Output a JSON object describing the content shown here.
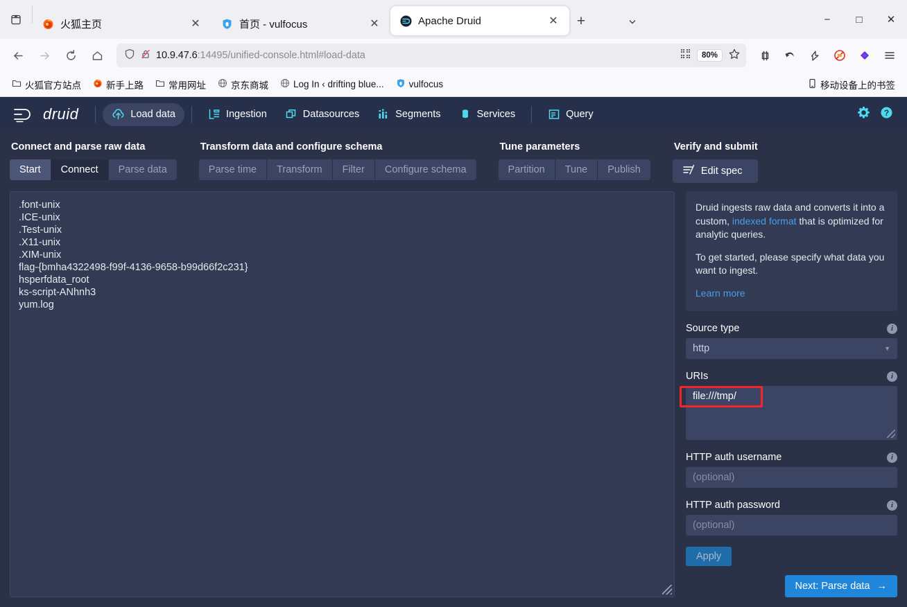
{
  "browser": {
    "tabs": [
      {
        "title": "火狐主页",
        "favicon": "firefox-icon",
        "active": false
      },
      {
        "title": "首页 - vulfocus",
        "favicon": "shield-icon",
        "active": false
      },
      {
        "title": "Apache Druid",
        "favicon": "druid-icon",
        "active": true
      }
    ],
    "tab_close_label": "✕",
    "new_tab_label": "+",
    "list_all_tabs_label": "⌄",
    "window_controls": {
      "minimize": "−",
      "maximize": "□",
      "close": "✕"
    },
    "nav": {
      "back": "←",
      "forward": "→",
      "reload": "⟳",
      "home": "⌂"
    },
    "url": {
      "host": "10.9.47.6",
      "rest": ":14495/unified-console.html#load-data",
      "shield_icon": "shield-icon",
      "lock_broken_icon": "lock-broken-icon",
      "qr_icon": "qr-code-icon",
      "zoom_level": "80%",
      "bookmark_icon": "star-icon"
    },
    "toolbar_icons": [
      "screenshot-icon",
      "undo-arrow-icon",
      "pocket-icon",
      "adblock-disabled-icon",
      "extension-diamond-icon",
      "app-menu-icon"
    ],
    "bookmarks": [
      {
        "label": "火狐官方站点",
        "icon": "folder-icon"
      },
      {
        "label": "新手上路",
        "icon": "firefox-icon"
      },
      {
        "label": "常用网址",
        "icon": "folder-icon"
      },
      {
        "label": "京东商城",
        "icon": "globe-icon"
      },
      {
        "label": "Log In ‹ drifting blue...",
        "icon": "globe-icon"
      },
      {
        "label": "vulfocus",
        "icon": "shield-icon"
      }
    ],
    "bookmarks_right": {
      "label": "移动设备上的书签",
      "icon": "mobile-icon"
    }
  },
  "druid": {
    "logo_text": "druid",
    "nav_items": [
      {
        "label": "Load data",
        "icon": "upload-cloud-icon",
        "active": true
      },
      {
        "label": "Ingestion",
        "icon": "ingestion-icon",
        "active": false
      },
      {
        "label": "Datasources",
        "icon": "datasources-icon",
        "active": false
      },
      {
        "label": "Segments",
        "icon": "segments-icon",
        "active": false
      },
      {
        "label": "Services",
        "icon": "services-icon",
        "active": false
      },
      {
        "label": "Query",
        "icon": "query-icon",
        "active": false
      }
    ],
    "nav_right": [
      {
        "icon": "gear-icon"
      },
      {
        "icon": "help-icon"
      }
    ],
    "wizard": [
      {
        "title": "Connect and parse raw data",
        "steps": [
          {
            "label": "Start",
            "state": "available"
          },
          {
            "label": "Connect",
            "state": "active"
          },
          {
            "label": "Parse data",
            "state": "disabled"
          }
        ]
      },
      {
        "title": "Transform data and configure schema",
        "steps": [
          {
            "label": "Parse time",
            "state": "disabled"
          },
          {
            "label": "Transform",
            "state": "disabled"
          },
          {
            "label": "Filter",
            "state": "disabled"
          },
          {
            "label": "Configure schema",
            "state": "disabled"
          }
        ]
      },
      {
        "title": "Tune parameters",
        "steps": [
          {
            "label": "Partition",
            "state": "disabled"
          },
          {
            "label": "Tune",
            "state": "disabled"
          },
          {
            "label": "Publish",
            "state": "disabled"
          }
        ]
      },
      {
        "title": "Verify and submit",
        "steps": [
          {
            "label": "Edit spec",
            "state": "editspec",
            "icon": "edit-spec-icon"
          }
        ]
      }
    ],
    "raw_data_lines": [
      ".font-unix",
      ".ICE-unix",
      ".Test-unix",
      ".X11-unix",
      ".XIM-unix",
      "flag-{bmha4322498-f99f-4136-9658-b99d66f2c231}",
      "hsperfdata_root",
      "ks-script-ANhnh3",
      "yum.log"
    ],
    "sidebar": {
      "info_p1_a": "Druid ingests raw data and converts it into a custom, ",
      "info_link1": "indexed format",
      "info_p1_b": " that is optimized for analytic queries.",
      "info_p2": "To get started, please specify what data you want to ingest.",
      "learn_more": "Learn more",
      "source_type_label": "Source type",
      "source_type_value": "http",
      "uris_label": "URIs",
      "uris_value": "file:///tmp/",
      "http_user_label": "HTTP auth username",
      "http_user_placeholder": "(optional)",
      "http_pass_label": "HTTP auth password",
      "http_pass_placeholder": "(optional)",
      "apply_label": "Apply",
      "next_label": "Next: Parse data",
      "next_arrow": "→",
      "info_icon": "i"
    }
  }
}
